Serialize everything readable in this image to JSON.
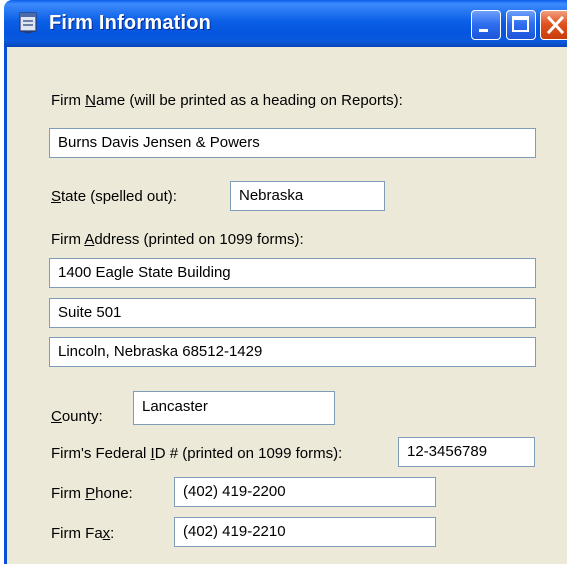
{
  "window": {
    "title": "Firm Information"
  },
  "form": {
    "firm_name_label_pre": "Firm ",
    "firm_name_label_key": "N",
    "firm_name_label_post": "ame (will be printed as a heading on Reports):",
    "firm_name_value": "Burns Davis Jensen & Powers",
    "state_label_key": "S",
    "state_label_post": "tate (spelled out):",
    "state_value": "Nebraska",
    "address_label_pre": "Firm ",
    "address_label_key": "A",
    "address_label_post": "ddress (printed on 1099 forms):",
    "address_line1": "1400 Eagle State Building",
    "address_line2": "Suite 501",
    "address_line3": "Lincoln, Nebraska   68512-1429",
    "county_label_key": "C",
    "county_label_post": "ounty:",
    "county_value": "Lancaster",
    "federal_id_label_pre": "Firm's Federal ",
    "federal_id_label_key": "I",
    "federal_id_label_post": "D # (printed on 1099 forms):",
    "federal_id_value": "12-3456789",
    "phone_label_pre": "Firm ",
    "phone_label_key": "P",
    "phone_label_post": "hone:",
    "phone_value": "(402) 419-2200",
    "fax_label_pre": "Firm Fa",
    "fax_label_key": "x",
    "fax_label_post": ":",
    "fax_value": "(402) 419-2210"
  },
  "icons": {
    "app": "app-window-icon",
    "minimize": "minimize-icon",
    "maximize": "maximize-icon",
    "close": "close-icon"
  },
  "colors": {
    "titlebar": "#0655e0",
    "client_background": "#ece9d8",
    "field_border": "#7f9db9",
    "close_button": "#e0531f"
  }
}
